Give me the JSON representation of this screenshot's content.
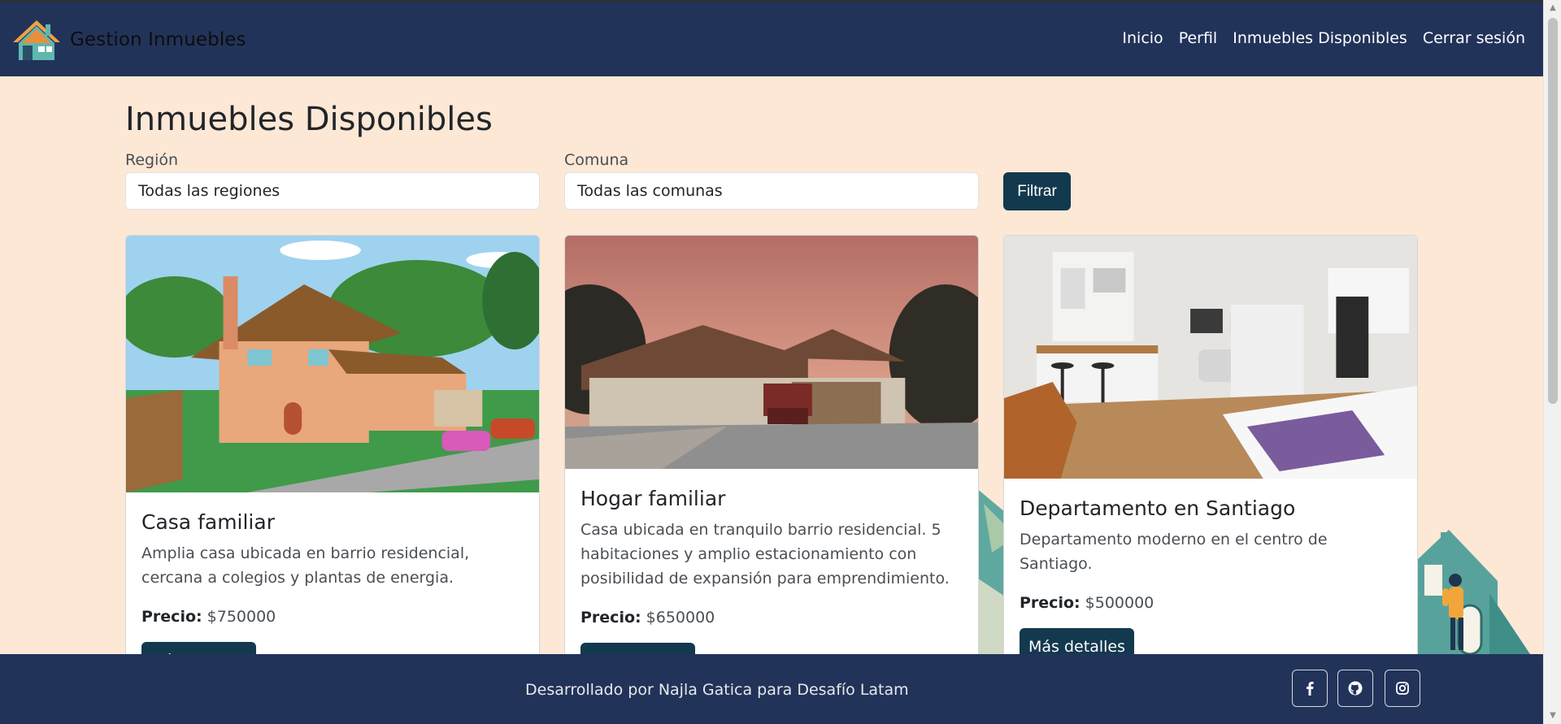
{
  "brand": {
    "name": "Gestion Inmuebles"
  },
  "nav": {
    "links": [
      "Inicio",
      "Perfil",
      "Inmuebles Disponibles",
      "Cerrar sesión"
    ]
  },
  "main": {
    "title": "Inmuebles Disponibles",
    "filters": {
      "region_label": "Región",
      "region_value": "Todas las regiones",
      "comuna_label": "Comuna",
      "comuna_value": "Todas las comunas",
      "filter_button": "Filtrar"
    },
    "price_label": "Precio:",
    "details_button": "Más detalles",
    "cards": [
      {
        "title": "Casa familiar",
        "description": "Amplia casa ubicada en barrio residencial, cercana a colegios y plantas de energia.",
        "price": "$750000",
        "image": "cartoon-two-story-house-photo"
      },
      {
        "title": "Hogar familiar",
        "description": "Casa ubicada en tranquilo barrio residencial. 5 habitaciones y amplio estacionamiento con posibilidad de expansión para emprendimiento.",
        "price": "$650000",
        "image": "suburban-house-at-dusk-photo"
      },
      {
        "title": "Departamento en Santiago",
        "description": "Departamento moderno en el centro de Santiago.",
        "price": "$500000",
        "image": "modern-studio-apartment-photo"
      }
    ]
  },
  "footer": {
    "text": "Desarrollado por Najla Gatica para Desafío Latam",
    "icons": [
      "facebook-icon",
      "github-icon",
      "instagram-icon"
    ]
  },
  "colors": {
    "navbar": "#22335a",
    "background": "#fde8d6",
    "button": "#13394f",
    "footer": "#22335a"
  }
}
